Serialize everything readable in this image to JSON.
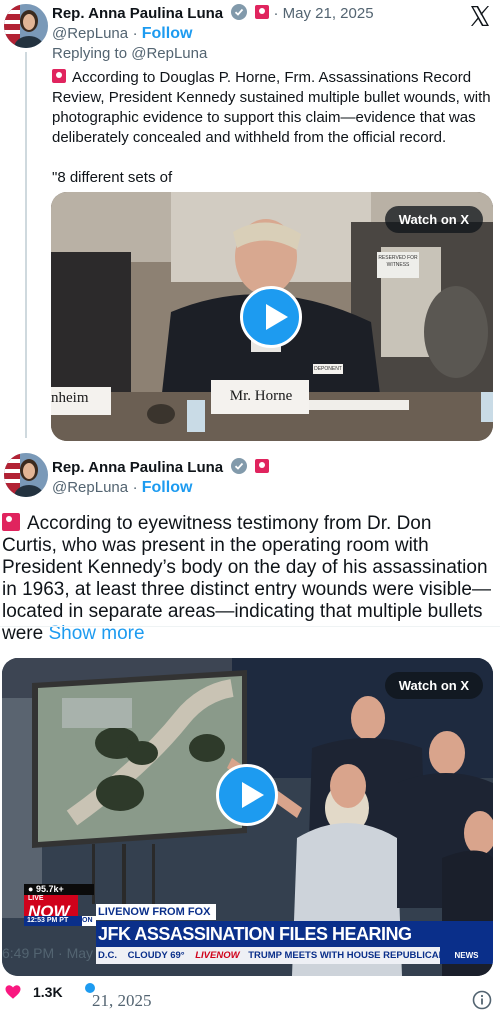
{
  "tweet1": {
    "author_name": "Rep. Anna Paulina Luna",
    "date": "· May 21, 2025",
    "handle": "@RepLuna",
    "follow": "Follow",
    "reply_prefix": "Replying to ",
    "reply_handle": "@RepLuna",
    "text_lines": [
      "According to Douglas P. Horne, Frm. Assassinations Record",
      "Review, President Kennedy sustained multiple bullet wounds, with",
      "photographic evidence to support this claim—evidence that was",
      "deliberately concealed and withheld from the official record."
    ],
    "quote_start": "\"8 different sets of",
    "watch_label": "Watch on X",
    "video_placard": "Mr. Horne",
    "video_placard_left": "nheim",
    "reserved_sign": "RESERVED FOR WITNESS",
    "name_tag": "DEPONENT"
  },
  "tweet2": {
    "author_name": "Rep. Anna Paulina Luna",
    "handle": "@RepLuna",
    "follow": "Follow",
    "text_lines": [
      "According to eyewitness testimony from Dr. Don",
      "Curtis, who was present in the operating room with",
      "President Kennedy’s body on the day of his assassination",
      "in 1963, at least three distinct entry wounds were visible—",
      "located in separate areas—indicating that multiple bullets"
    ],
    "last_line_prefix": "were ",
    "show_more": "Show more",
    "watch_label": "Watch on X",
    "chyron": {
      "viewers": "95.7k+",
      "live": "LIVE",
      "now": "NOW",
      "time": "12:53 PM PT",
      "on": "ON",
      "source": "LIVENOW FROM FOX",
      "headline": "JFK ASSASSINATION FILES HEARING",
      "location": "D.C.",
      "weather": "CLOUDY 69°",
      "ticker_logo": "LIVENOW",
      "ticker": "TRUMP MEETS WITH HOUSE REPUBLICANS TO R",
      "news_tag": "NEWS"
    },
    "timestamp": "6:49 PM · May",
    "timestamp_overlap": "21, 2025",
    "likes": "1.3K"
  },
  "icons": [
    "x-logo-icon",
    "verified-badge-icon",
    "siren-emoji-icon",
    "play-icon",
    "heart-icon",
    "info-icon"
  ],
  "colors": {
    "accent": "#1d9bf0",
    "like": "#f91880",
    "siren": "#e0245e",
    "fox_red": "#d0021b",
    "fox_blue": "#0a2f8a"
  }
}
